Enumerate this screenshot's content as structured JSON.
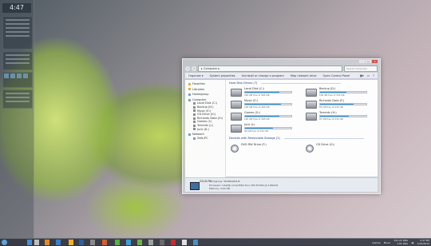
{
  "desktop": {
    "clock_widget": "4:47"
  },
  "window": {
    "title": "",
    "controls": {
      "min": "–",
      "max": "□",
      "close": "×"
    },
    "address": "▸ Computer ▸",
    "search_placeholder": "Search Computer",
    "toolbar": [
      "Organize ▾",
      "System properties",
      "Uninstall or change a program",
      "Map network drive",
      "Open Control Panel"
    ],
    "nav": [
      {
        "label": "Favorites",
        "indent": false,
        "icon": "star-icon"
      },
      {
        "label": "Libraries",
        "indent": false,
        "icon": "library-icon"
      },
      {
        "label": "Homegroup",
        "indent": false,
        "icon": "homegroup-icon"
      },
      {
        "label": "Computer",
        "indent": false,
        "icon": "computer-icon"
      },
      {
        "label": "Local Disk (C:)",
        "indent": true,
        "icon": "drive-icon"
      },
      {
        "label": "Backup (D:)",
        "indent": true,
        "icon": "drive-icon"
      },
      {
        "label": "Music (E:)",
        "indent": true,
        "icon": "drive-icon"
      },
      {
        "label": "CD Drive (H:)",
        "indent": true,
        "icon": "cd-icon"
      },
      {
        "label": "Richards Data (H:)",
        "indent": true,
        "icon": "drive-icon"
      },
      {
        "label": "Games (I:)",
        "indent": true,
        "icon": "drive-icon"
      },
      {
        "label": "Torrents (J:)",
        "indent": true,
        "icon": "drive-icon"
      },
      {
        "label": "Junk (K:)",
        "indent": true,
        "icon": "drive-icon"
      },
      {
        "label": "Network",
        "indent": false,
        "icon": "network-icon"
      },
      {
        "label": "Zalb-PC",
        "indent": true,
        "icon": "computer-icon"
      }
    ],
    "hdd_group": "Hard Disk Drives (7)",
    "drives": [
      {
        "name": "Local Disk (C:)",
        "free": "120 GB free of 465 GB",
        "used": 0.74
      },
      {
        "name": "Backup (D:)",
        "free": "100 GB free of 232 GB",
        "used": 0.57
      },
      {
        "name": "Music (E:)",
        "free": "100 GB free of 465 GB",
        "used": 0.78
      },
      {
        "name": "Richards Data (F:)",
        "free": "65 GB free of 232 GB",
        "used": 0.72
      },
      {
        "name": "Games (G:)",
        "free": "120 GB free of 465 GB",
        "used": 0.74
      },
      {
        "name": "Torrents (H:)",
        "free": "87 GB free of 232 GB",
        "used": 0.62
      },
      {
        "name": "Junk (I:)",
        "free": "90 GB free of 232 GB",
        "used": 0.61
      }
    ],
    "removable_group": "Devices with Removable Storage (2)",
    "removable": [
      {
        "name": "DVD RW Drive (F:)"
      },
      {
        "name": "CD Drive (G:)"
      }
    ],
    "details": {
      "pc_name": "ZALB-PC",
      "workgroup": "Workgroup: WORKGROUP",
      "processor": "Processor: Intel(R) Core(TM)2 Duo CPU     E7400  @ 2.80GHz",
      "memory": "Memory: 4.00 GB"
    }
  },
  "taskbar": {
    "tray_label": "Games",
    "tray_label2": "Music",
    "net1": "191.22 kB/s",
    "net2": "1.83 kB/s",
    "time": "4:47 PM",
    "date": "1/25/2010"
  }
}
